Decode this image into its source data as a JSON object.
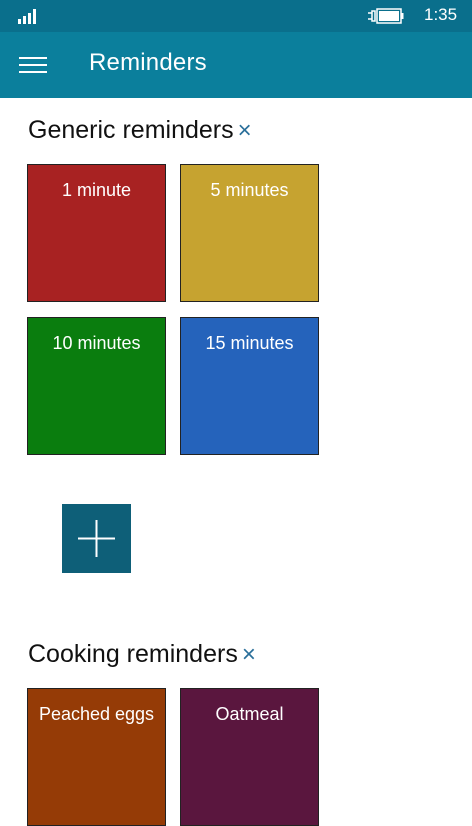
{
  "status_bar": {
    "time": "1:35",
    "signal_icon": "signal-icon",
    "battery_icon": "battery-charging-icon"
  },
  "app_bar": {
    "menu_icon": "hamburger-menu-icon",
    "title": "Reminders"
  },
  "groups": [
    {
      "title": "Generic reminders",
      "close_icon": "×",
      "tiles": [
        {
          "label": "1 minute",
          "color": "#a82222"
        },
        {
          "label": "5 minutes",
          "color": "#c6a330"
        },
        {
          "label": "10 minutes",
          "color": "#0a7d0e"
        },
        {
          "label": "15 minutes",
          "color": "#2563bb"
        }
      ],
      "add_icon": "plus-icon"
    },
    {
      "title": "Cooking reminders",
      "close_icon": "×",
      "tiles": [
        {
          "label": "Peached eggs",
          "color": "#953b06"
        },
        {
          "label": "Oatmeal",
          "color": "#5a163e"
        }
      ]
    }
  ]
}
